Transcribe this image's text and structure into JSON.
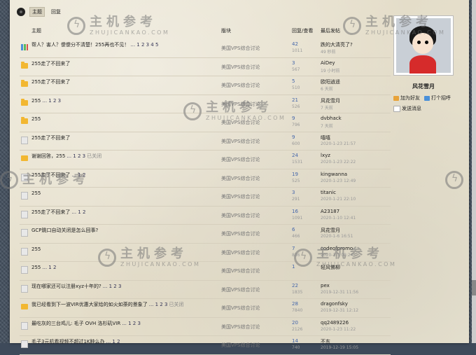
{
  "tabs": [
    {
      "label": "主题",
      "active": true
    },
    {
      "label": "回复",
      "active": false
    }
  ],
  "table_header": {
    "topic": "主题",
    "forum": "版块",
    "replies_views": "回复/查看",
    "last_post": "最后发帖"
  },
  "rows": [
    {
      "icon": "chart-icon",
      "title": "帮人？害人？傻傻分不清楚！255再也不见！",
      "pages": "... 1 2 3 4 5",
      "closed": "",
      "forum": "美国VPS综合讨论",
      "replies": "42",
      "views": "1011",
      "last_user": "跌的大清亮了?",
      "last_time": "49 秒前"
    },
    {
      "icon": "folder-icon",
      "title": "255走了不回来了",
      "pages": "",
      "closed": "",
      "forum": "美国VPS综合讨论",
      "replies": "3",
      "views": "567",
      "last_user": "AiDey",
      "last_time": "19 小时前"
    },
    {
      "icon": "folder-icon",
      "title": "255走了不回来了",
      "pages": "",
      "closed": "",
      "forum": "美国VPS综合讨论",
      "replies": "5",
      "views": "510",
      "last_user": "欧阳逍遥",
      "last_time": "6 天前"
    },
    {
      "icon": "folder-icon",
      "title": "255",
      "pages": "... 1 2 3",
      "closed": "",
      "forum": "美国VPS综合讨论",
      "replies": "21",
      "views": "526",
      "last_user": "风花雪月",
      "last_time": "7 天前"
    },
    {
      "icon": "folder-icon",
      "title": "255",
      "pages": "",
      "closed": "",
      "forum": "美国VPS综合讨论",
      "replies": "9",
      "views": "796",
      "last_user": "dvbhack",
      "last_time": "7 天前"
    },
    {
      "icon": "doc-icon",
      "title": "255走了不回来了",
      "pages": "",
      "closed": "",
      "forum": "美国VPS综合讨论",
      "replies": "9",
      "views": "600",
      "last_user": "嘻嘻",
      "last_time": "2020-1-23 21:57"
    },
    {
      "icon": "hot-icon",
      "title": "谢谢回答，255",
      "pages": "... 1 2 3",
      "closed": "已关闭",
      "forum": "美国VPS综合讨论",
      "replies": "24",
      "views": "1531",
      "last_user": "lxyz",
      "last_time": "2020-1-23 22:22"
    },
    {
      "icon": "doc-icon",
      "title": "255走了不回来了",
      "pages": "... 1 2",
      "closed": "",
      "forum": "美国VPS综合讨论",
      "replies": "19",
      "views": "525",
      "last_user": "kingwanna",
      "last_time": "2020-1-23 12:49"
    },
    {
      "icon": "doc-icon",
      "title": "255",
      "pages": "",
      "closed": "",
      "forum": "美国VPS综合讨论",
      "replies": "3",
      "views": "291",
      "last_user": "titanic",
      "last_time": "2020-1-21 22:10"
    },
    {
      "icon": "doc-icon",
      "title": "255走了不回来了",
      "pages": "... 1 2",
      "closed": "",
      "forum": "美国VPS综合讨论",
      "replies": "16",
      "views": "1091",
      "last_user": "A23187",
      "last_time": "2020-1-10 12:41"
    },
    {
      "icon": "doc-icon",
      "title": "GCP跳口自动关闭是怎么回事?",
      "pages": "",
      "closed": "",
      "forum": "美国VPS综合讨论",
      "replies": "6",
      "views": "466",
      "last_user": "风花雪月",
      "last_time": "2020-1-6 16:51"
    },
    {
      "icon": "doc-icon",
      "title": "255",
      "pages": "",
      "closed": "",
      "forum": "美国VPS综合讨论",
      "replies": "7",
      "views": "836",
      "last_user": "codeofpromo",
      "last_time": "2020-1-1 08:24"
    },
    {
      "icon": "doc-icon",
      "title": "255",
      "pages": "... 1 2",
      "closed": "",
      "forum": "美国VPS综合讨论",
      "replies": "1",
      "views": "",
      "last_user": "轻风佛柳",
      "last_time": ""
    },
    {
      "icon": "doc-icon",
      "title": "现在哪家还可以注册xyz十年的?",
      "pages": "... 1 2 3",
      "closed": "",
      "forum": "美国VPS综合讨论",
      "replies": "22",
      "views": "1835",
      "last_user": "pex",
      "last_time": "2019-12-31 11:56"
    },
    {
      "icon": "hot-icon",
      "title": "我已经看到下一波VIR优惠大家给的如火如荼的景象了",
      "pages": "... 1 2 3",
      "closed": "已关闭",
      "forum": "美国VPS综合讨论",
      "replies": "28",
      "views": "7840",
      "last_user": "dragonfsky",
      "last_time": "2019-12-31 12:12"
    },
    {
      "icon": "doc-icon",
      "title": "最吃灰的三台鸡儿: 毛子 OVH 洛杉矶VIR",
      "pages": "... 1 2 3",
      "closed": "",
      "forum": "美国VPS综合讨论",
      "replies": "20",
      "views": "2126",
      "last_user": "qq2489226",
      "last_time": "2020-1-23 11:22"
    },
    {
      "icon": "doc-icon",
      "title": "毛子3元机看视频不超过1K肿么办",
      "pages": "... 1 2",
      "closed": "",
      "forum": "美国VPS综合讨论",
      "replies": "14",
      "views": "740",
      "last_user": "不东",
      "last_time": "2019-12-19 15:05"
    }
  ],
  "profile": {
    "name": "风花雪月",
    "add_friend": "加为好友",
    "greet": "打个招呼",
    "send_message": "发送消息"
  },
  "watermark": {
    "cn": "主机参考",
    "en": "ZHUJICANKAO.COM"
  }
}
